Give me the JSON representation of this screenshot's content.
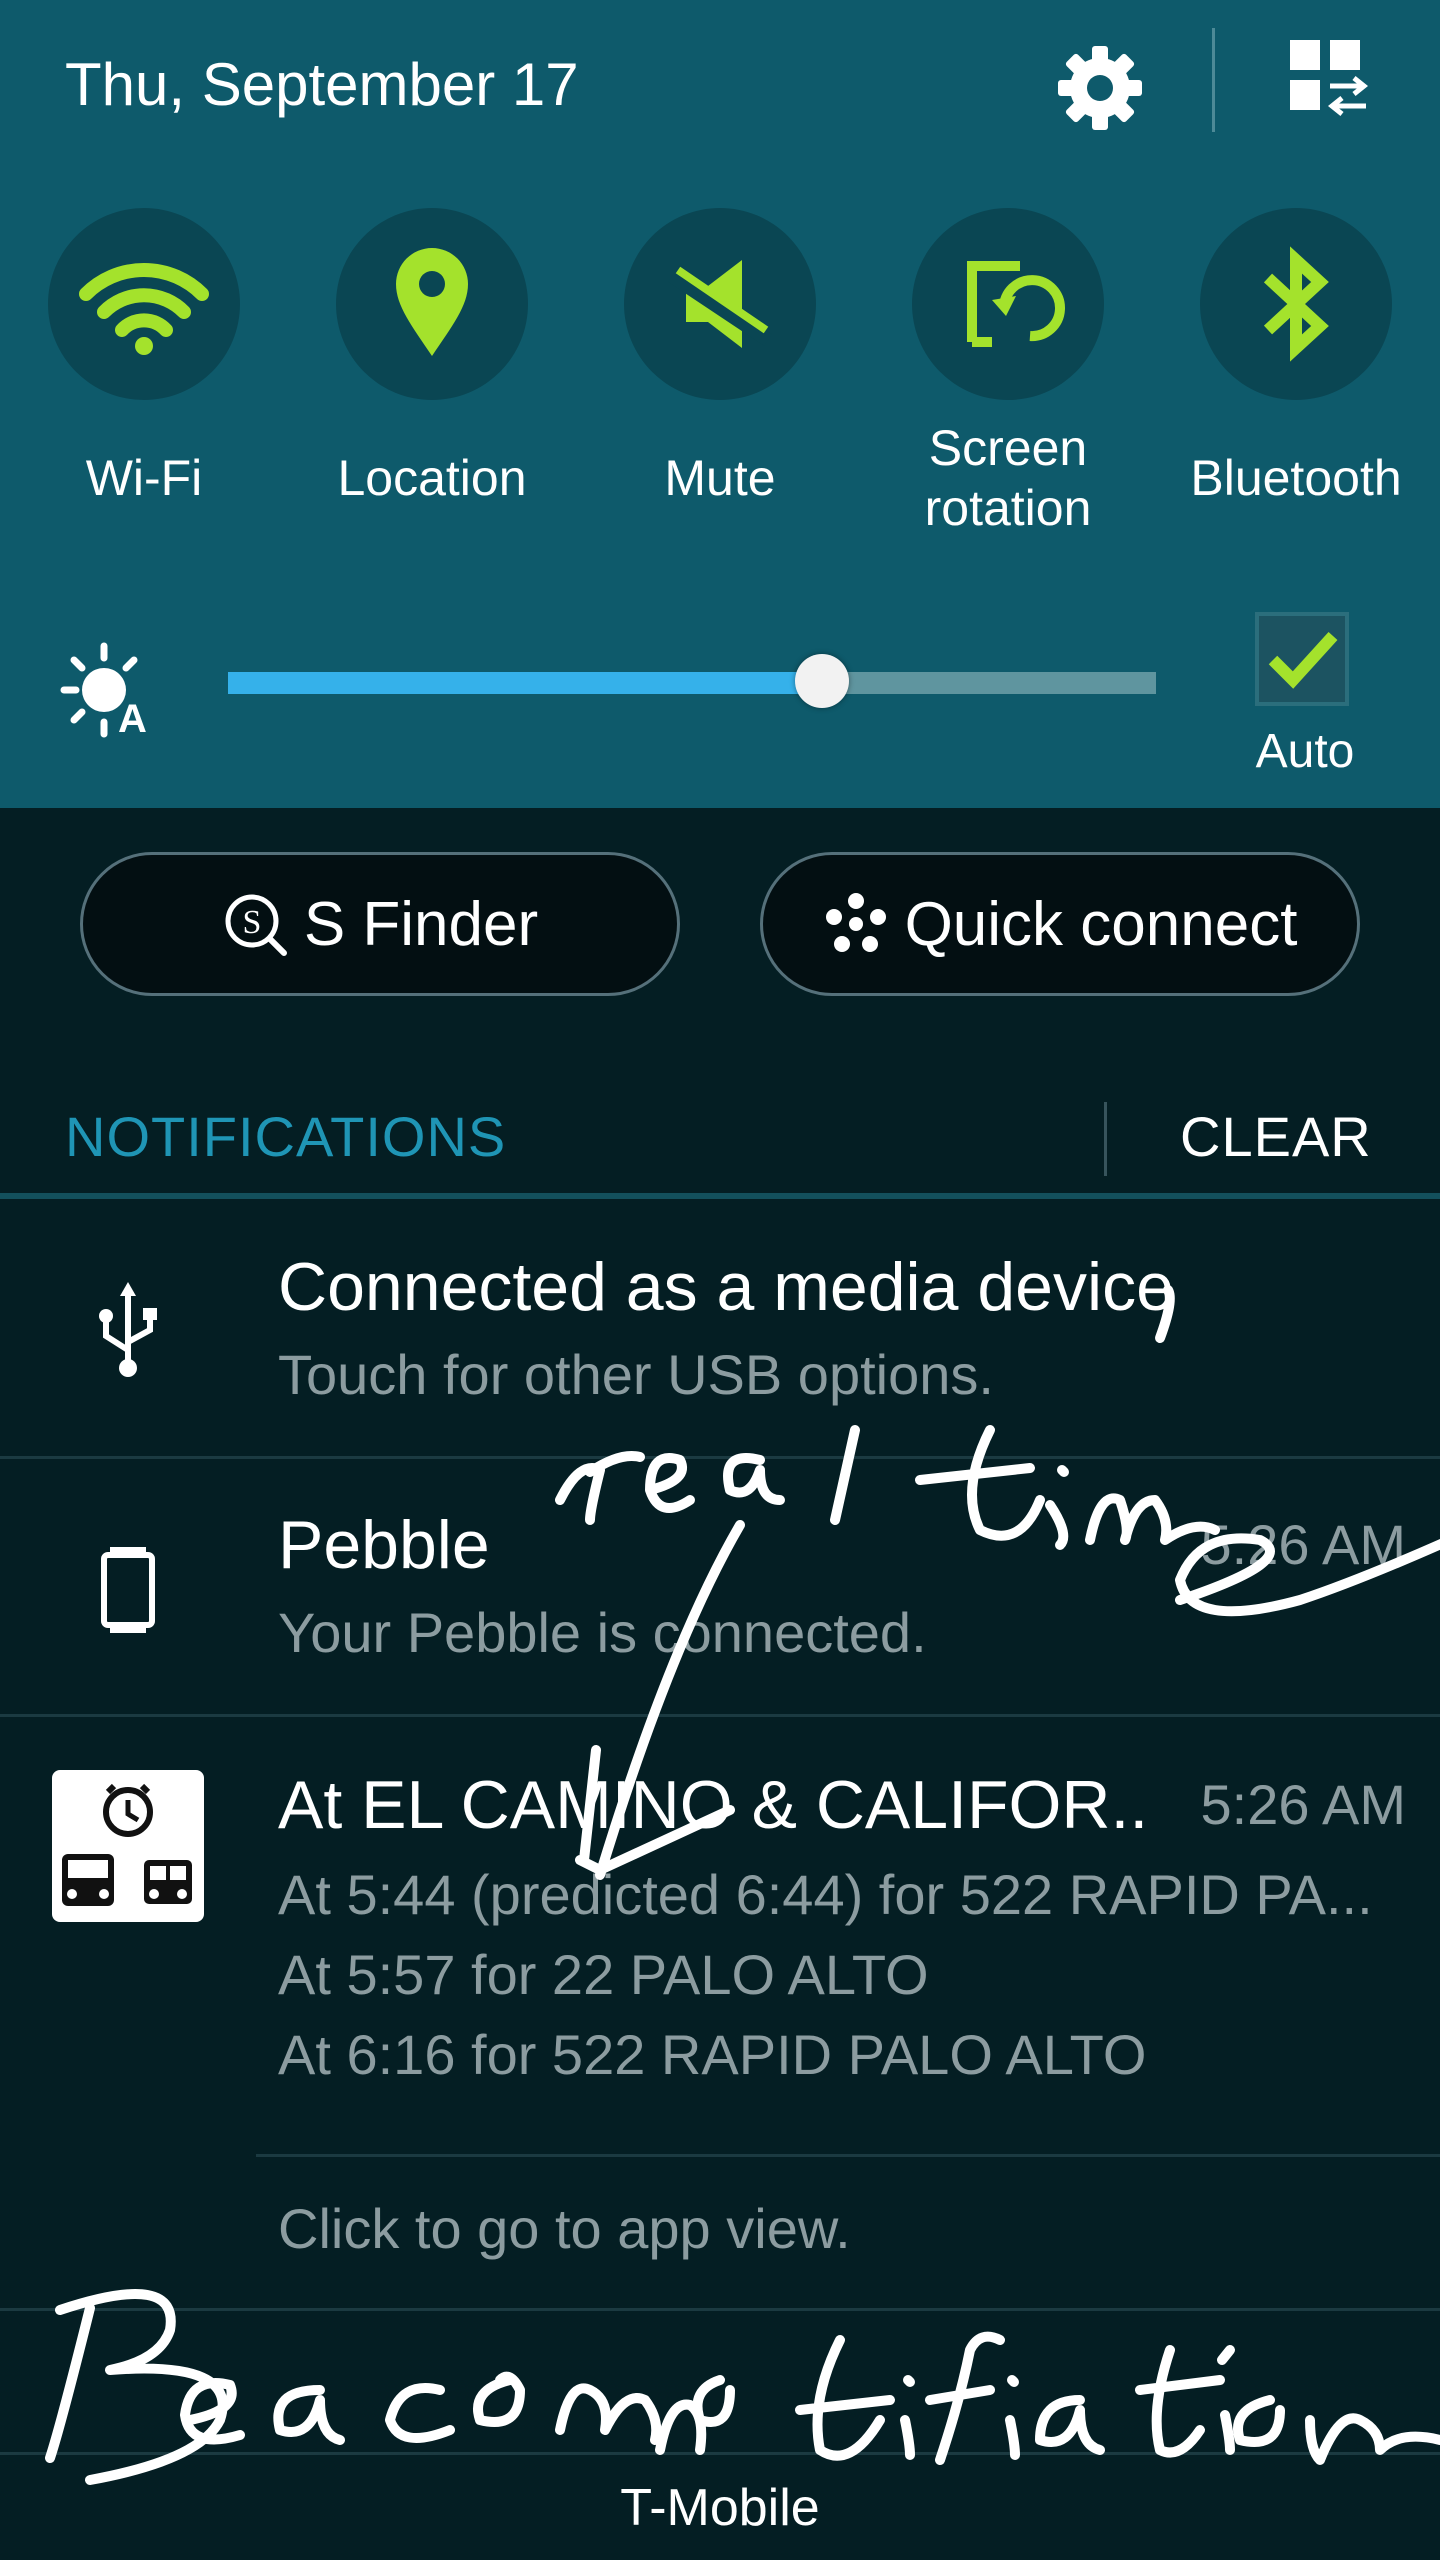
{
  "status": {
    "date": "Thu, September 17",
    "settings_icon": "gear-icon",
    "grid_icon": "grid-edit-icon"
  },
  "quick_settings": {
    "accent": "#a4e22c",
    "tiles": [
      {
        "label": "Wi-Fi",
        "icon": "wifi-icon"
      },
      {
        "label": "Location",
        "icon": "location-pin-icon"
      },
      {
        "label": "Mute",
        "icon": "mute-icon"
      },
      {
        "label": "Screen rotation",
        "icon": "screen-rotation-icon"
      },
      {
        "label": "Bluetooth",
        "icon": "bluetooth-icon"
      }
    ]
  },
  "brightness": {
    "level_percent": 64,
    "auto_label": "Auto",
    "auto_checked": true,
    "fill_color": "#35b1ea"
  },
  "buttons": {
    "s_finder": "S Finder",
    "quick_connect": "Quick connect"
  },
  "notifications": {
    "header": "NOTIFICATIONS",
    "clear": "CLEAR",
    "items": [
      {
        "title": "Connected as a media device",
        "subtitle": "Touch for other USB options.",
        "icon": "usb-icon"
      },
      {
        "title": "Pebble",
        "subtitle": "Your Pebble is connected.",
        "time": "5:26 AM",
        "icon": "smartwatch-icon"
      },
      {
        "title": "At EL CAMINO & CALIFOR..",
        "time": "5:26 AM",
        "icon": "bus-alarm-icon",
        "lines": [
          "At 5:44 (predicted 6:44) for 522 RAPID PA...",
          "At 5:57 for 22 PALO ALTO",
          "At 6:16 for 522 RAPID PALO ALTO"
        ]
      }
    ],
    "app_view": "Click to go to app view."
  },
  "annotations": {
    "handwriting_1": "real time",
    "handwriting_2": "Beacon notification"
  },
  "carrier": "T-Mobile"
}
